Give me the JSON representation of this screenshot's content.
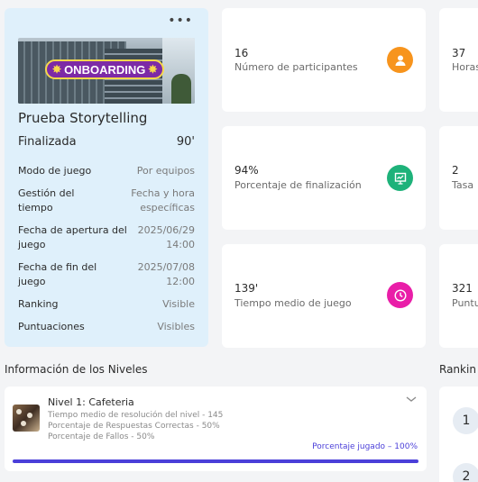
{
  "game": {
    "banner": "ONBOARDING",
    "title": "Prueba Storytelling",
    "status": "Finalizada",
    "duration": "90'",
    "details": [
      {
        "key": "Modo de juego",
        "value": "Por equipos"
      },
      {
        "key": "Gestión del tiempo",
        "value": "Fecha y hora específicas"
      },
      {
        "key": "Fecha de apertura del juego",
        "value": "2025/06/29 14:00"
      },
      {
        "key": "Fecha de fin del juego",
        "value": "2025/07/08 12:00"
      },
      {
        "key": "Ranking",
        "value": "Visible"
      },
      {
        "key": "Puntuaciones",
        "value": "Visibles"
      }
    ]
  },
  "stats": [
    {
      "value": "16",
      "label": "Número de participantes",
      "icon": "participants-icon",
      "color": "#f7941d"
    },
    {
      "value": "37",
      "label": "Horas"
    },
    {
      "value": "94%",
      "label": "Porcentaje de finalización",
      "icon": "presentation-icon",
      "color": "#1eb27a"
    },
    {
      "value": "2",
      "label": "Tasa"
    },
    {
      "value": "139'",
      "label": "Tiempo medio de juego",
      "icon": "clock-icon",
      "color": "#e91ea8"
    },
    {
      "value": "321",
      "label": "Puntu"
    }
  ],
  "levels": {
    "section_title": "Información de los Niveles",
    "items": [
      {
        "name": "Nivel 1: Cafeteria",
        "lines": [
          "Tiempo medio de resolución del nivel - 145",
          "Porcentaje de Respuestas Correctas - 50%",
          "Porcentaje de Fallos - 50%"
        ],
        "played_label": "Porcentaje jugado – 100%",
        "played_percent": 100
      }
    ]
  },
  "ranking": {
    "section_title": "Rankin",
    "positions": [
      "1",
      "2"
    ]
  }
}
